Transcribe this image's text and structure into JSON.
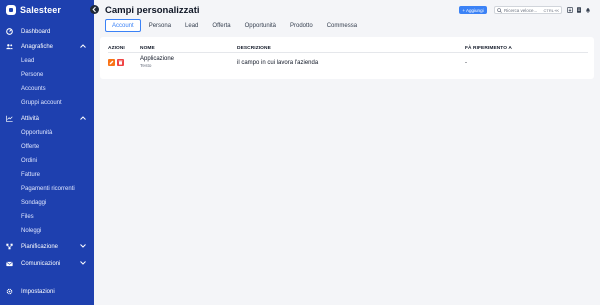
{
  "app": {
    "name": "Salesteer"
  },
  "sidebar": {
    "items": [
      {
        "key": "dashboard",
        "label": "Dashboard",
        "icon": "dashboard-icon"
      },
      {
        "key": "anagrafiche",
        "label": "Anagrafiche",
        "icon": "users-icon",
        "expanded": true,
        "children": [
          "Lead",
          "Persone",
          "Accounts",
          "Gruppi account"
        ]
      },
      {
        "key": "attivita",
        "label": "Attività",
        "icon": "chart-line-icon",
        "expanded": true,
        "children": [
          "Opportunità",
          "Offerte",
          "Ordini",
          "Fatture",
          "Pagamenti ricorrenti",
          "Sondaggi",
          "Files",
          "Noleggi"
        ]
      },
      {
        "key": "pianificazione",
        "label": "Pianificazione",
        "icon": "planning-icon",
        "expanded": false
      },
      {
        "key": "comunicazioni",
        "label": "Comunicazioni",
        "icon": "mail-icon",
        "expanded": false
      },
      {
        "key": "impostazioni",
        "label": "Impostazioni",
        "icon": "gear-icon"
      }
    ]
  },
  "header": {
    "title": "Campi personalizzati",
    "add_label": "+ Aggiungi",
    "search_placeholder": "Ricerca veloce...",
    "search_shortcut": "CTRL+K"
  },
  "tabs": [
    {
      "label": "Account",
      "active": true
    },
    {
      "label": "Persona",
      "active": false
    },
    {
      "label": "Lead",
      "active": false
    },
    {
      "label": "Offerta",
      "active": false
    },
    {
      "label": "Opportunità",
      "active": false
    },
    {
      "label": "Prodotto",
      "active": false
    },
    {
      "label": "Commessa",
      "active": false
    }
  ],
  "table": {
    "columns": [
      "AZIONI",
      "NOME",
      "DESCRIZIONE",
      "FÀ RIFERIMENTO A"
    ],
    "rows": [
      {
        "name": "Applicazione",
        "type": "Testo",
        "description": "il campo in cui lavora l'azienda",
        "reference": "-"
      }
    ]
  },
  "colors": {
    "sidebar": "#1e40af",
    "accent": "#3b82f6",
    "edit": "#f97316",
    "delete": "#ef4444"
  }
}
